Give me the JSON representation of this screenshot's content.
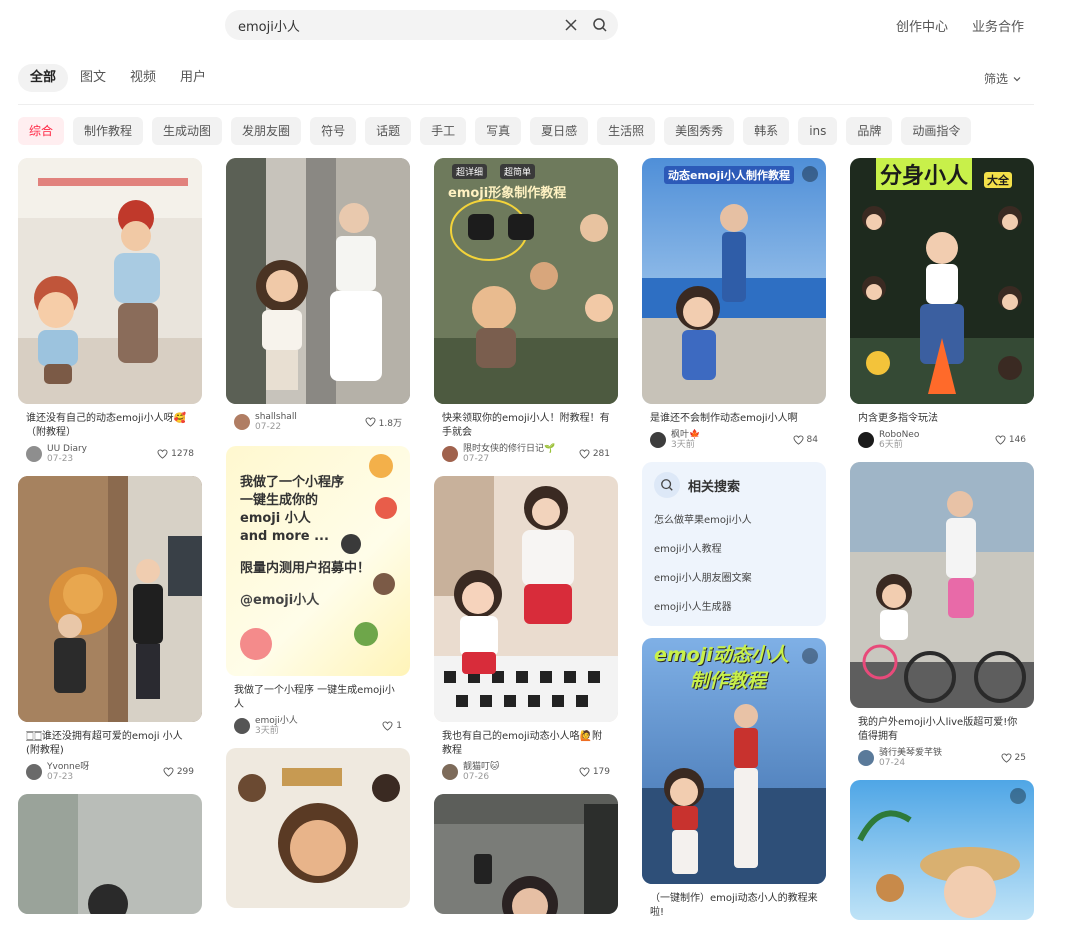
{
  "search": {
    "value": "emoji小人"
  },
  "top_links": [
    "创作中心",
    "业务合作"
  ],
  "tabs": [
    {
      "label": "全部",
      "active": true
    },
    {
      "label": "图文",
      "active": false
    },
    {
      "label": "视频",
      "active": false
    },
    {
      "label": "用户",
      "active": false
    }
  ],
  "filter_label": "筛选",
  "chips": [
    "综合",
    "制作教程",
    "生成动图",
    "发朋友圈",
    "符号",
    "话题",
    "手工",
    "写真",
    "夏日感",
    "生活照",
    "美图秀秀",
    "韩系",
    "ins",
    "品牌",
    "动画指令"
  ],
  "colors": {
    "accent": "#ff2442",
    "related_bg": "#eef4fc"
  },
  "related": {
    "title": "相关搜索",
    "items": [
      "怎么做苹果emoji小人",
      "emoji小人教程",
      "emoji小人朋友圈文案",
      "emoji小人生成器"
    ]
  },
  "cards": {
    "c1": {
      "title": "谁还没有自己的动态emoji小人呀🥰（附教程）",
      "author": "UU Diary",
      "date": "07-23",
      "likes": "1278"
    },
    "c2": {
      "title": "🀆🀆谁还没拥有超可爱的emoji 小人(附教程)",
      "author": "Yvonne呀",
      "date": "07-23",
      "likes": "299"
    },
    "c3": {
      "title": "",
      "author": "shallshall",
      "date": "07-22",
      "likes": "1.8万"
    },
    "c4": {
      "title": "我做了一个小程序 一键生成emoji小人",
      "author": "emoji小人",
      "date": "3天前",
      "likes": "1"
    },
    "c4_text": [
      "我做了一个小程序",
      "一键生成你的",
      "emoji 小人",
      "and more ...",
      "限量内测用户招募中！",
      "@emoji小人"
    ],
    "c5": {
      "title": "快来领取你的emoji小人！附教程！有手就会",
      "author": "限时女侠的修行日记🌱",
      "date": "07-27",
      "likes": "281"
    },
    "c5_overlay": [
      "超详细",
      "超简单",
      "emoji形象制作教程"
    ],
    "c6": {
      "title": "我也有自己的emoji动态小人咯🙋附教程",
      "author": "靓猫叮🐱",
      "date": "07-26",
      "likes": "179"
    },
    "c7": {
      "title": "是谁还不会制作动态emoji小人啊",
      "author": "枫叶🍁",
      "date": "3天前",
      "likes": "84"
    },
    "c7_overlay": "动态emoji小人制作教程",
    "c8": {
      "title": "（一键制作）emoji动态小人的教程来啦!"
    },
    "c8_overlay": [
      "emoji动态小人",
      "制作教程"
    ],
    "c9": {
      "title": "内含更多指令玩法",
      "author": "RoboNeo",
      "date": "6天前",
      "likes": "146"
    },
    "c9_overlay": [
      "分身小人",
      "大全"
    ],
    "c10": {
      "title": "我的户外emoji小人live版超可爱!你值得拥有",
      "author": "骑行美琴爱芊铁",
      "date": "07-24",
      "likes": "25"
    }
  }
}
